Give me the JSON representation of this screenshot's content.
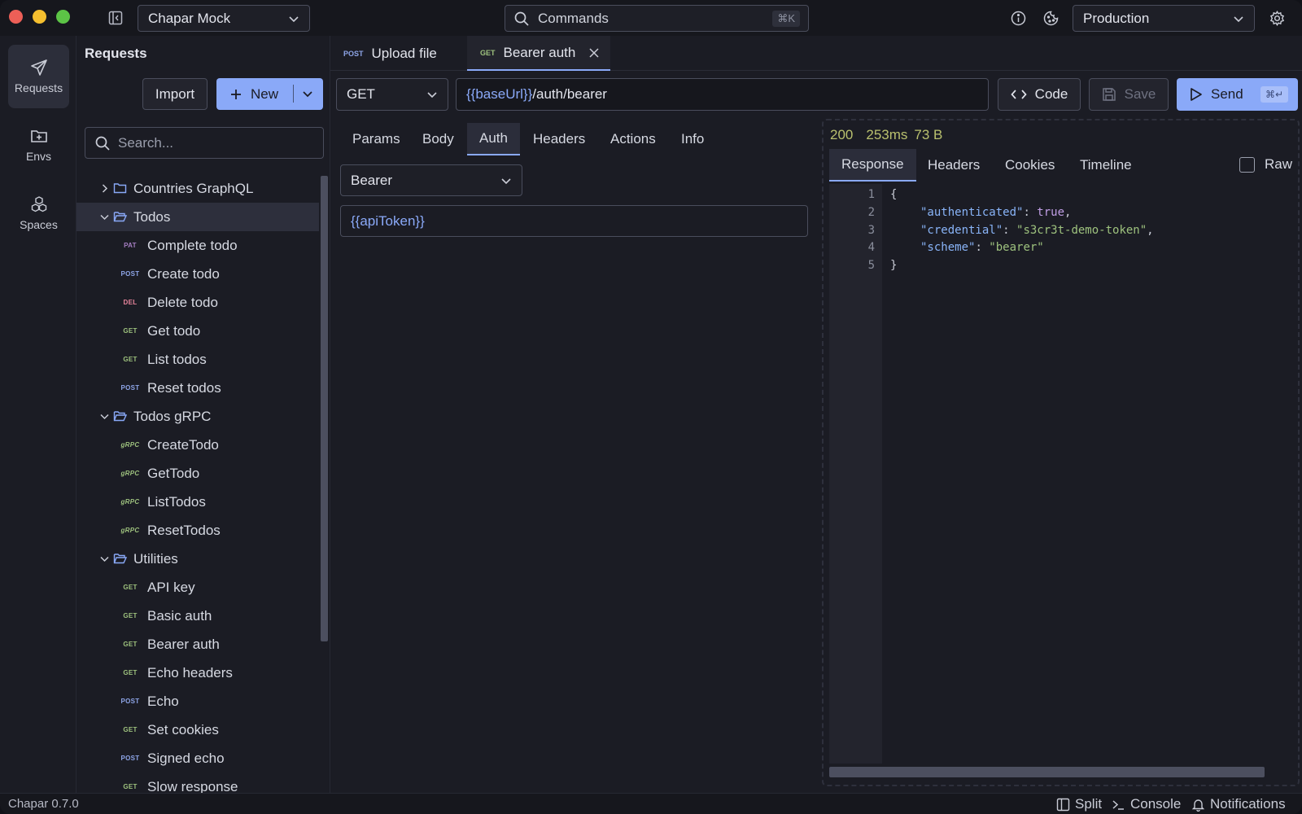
{
  "titlebar": {
    "workspace": "Chapar Mock",
    "commands_label": "Commands",
    "commands_shortcut": "⌘K",
    "environment": "Production"
  },
  "activity": [
    {
      "label": "Requests",
      "icon": "send-icon"
    },
    {
      "label": "Envs",
      "icon": "folder-plus-icon"
    },
    {
      "label": "Spaces",
      "icon": "cubes-icon"
    }
  ],
  "requests_panel": {
    "title": "Requests",
    "import_label": "Import",
    "new_label": "New",
    "search_placeholder": "Search..."
  },
  "tree": [
    {
      "type": "folder",
      "label": "Countries GraphQL",
      "open": false
    },
    {
      "type": "folder",
      "label": "Todos",
      "open": true,
      "selected": true
    },
    {
      "type": "request",
      "method": "PAT",
      "label": "Complete todo"
    },
    {
      "type": "request",
      "method": "POST",
      "label": "Create todo"
    },
    {
      "type": "request",
      "method": "DEL",
      "label": "Delete todo"
    },
    {
      "type": "request",
      "method": "GET",
      "label": "Get todo"
    },
    {
      "type": "request",
      "method": "GET",
      "label": "List todos"
    },
    {
      "type": "request",
      "method": "POST",
      "label": "Reset todos"
    },
    {
      "type": "folder",
      "label": "Todos gRPC",
      "open": true
    },
    {
      "type": "request",
      "method": "gRPC",
      "label": "CreateTodo"
    },
    {
      "type": "request",
      "method": "gRPC",
      "label": "GetTodo"
    },
    {
      "type": "request",
      "method": "gRPC",
      "label": "ListTodos"
    },
    {
      "type": "request",
      "method": "gRPC",
      "label": "ResetTodos"
    },
    {
      "type": "folder",
      "label": "Utilities",
      "open": true
    },
    {
      "type": "request",
      "method": "GET",
      "label": "API key"
    },
    {
      "type": "request",
      "method": "GET",
      "label": "Basic auth"
    },
    {
      "type": "request",
      "method": "GET",
      "label": "Bearer auth"
    },
    {
      "type": "request",
      "method": "GET",
      "label": "Echo headers"
    },
    {
      "type": "request",
      "method": "POST",
      "label": "Echo"
    },
    {
      "type": "request",
      "method": "GET",
      "label": "Set cookies"
    },
    {
      "type": "request",
      "method": "POST",
      "label": "Signed echo"
    },
    {
      "type": "request",
      "method": "GET",
      "label": "Slow response"
    }
  ],
  "open_tabs": [
    {
      "method": "POST",
      "label": "Upload file",
      "active": false
    },
    {
      "method": "GET",
      "label": "Bearer auth",
      "active": true
    }
  ],
  "request": {
    "method": "GET",
    "url_var": "{{baseUrl}}",
    "url_path": "/auth/bearer",
    "code_label": "Code",
    "save_label": "Save",
    "send_label": "Send",
    "send_shortcut": "⌘↵",
    "subtabs": [
      "Params",
      "Body",
      "Auth",
      "Headers",
      "Actions",
      "Info"
    ],
    "active_subtab": "Auth",
    "auth_type": "Bearer",
    "token": "{{apiToken}}"
  },
  "response": {
    "status": "200",
    "time": "253ms",
    "size": "73 B",
    "tabs": [
      "Response",
      "Headers",
      "Cookies",
      "Timeline"
    ],
    "active_tab": "Response",
    "raw_label": "Raw",
    "line_numbers": [
      "1",
      "2",
      "3",
      "4",
      "5"
    ],
    "body": {
      "open": "{",
      "k1": "\"authenticated\"",
      "v1": "true",
      "k2": "\"credential\"",
      "v2": "\"s3cr3t-demo-token\"",
      "k3": "\"scheme\"",
      "v3": "\"bearer\"",
      "close": "}"
    }
  },
  "statusbar": {
    "version": "Chapar 0.7.0",
    "split_label": "Split",
    "console_label": "Console",
    "notifications_label": "Notifications"
  },
  "colors": {
    "accent": "#8aa9f8",
    "get": "#9ec27e",
    "post": "#8ea5e8",
    "patch": "#a57ec2",
    "delete": "#e8849c",
    "status_ok": "#b9c06e"
  }
}
